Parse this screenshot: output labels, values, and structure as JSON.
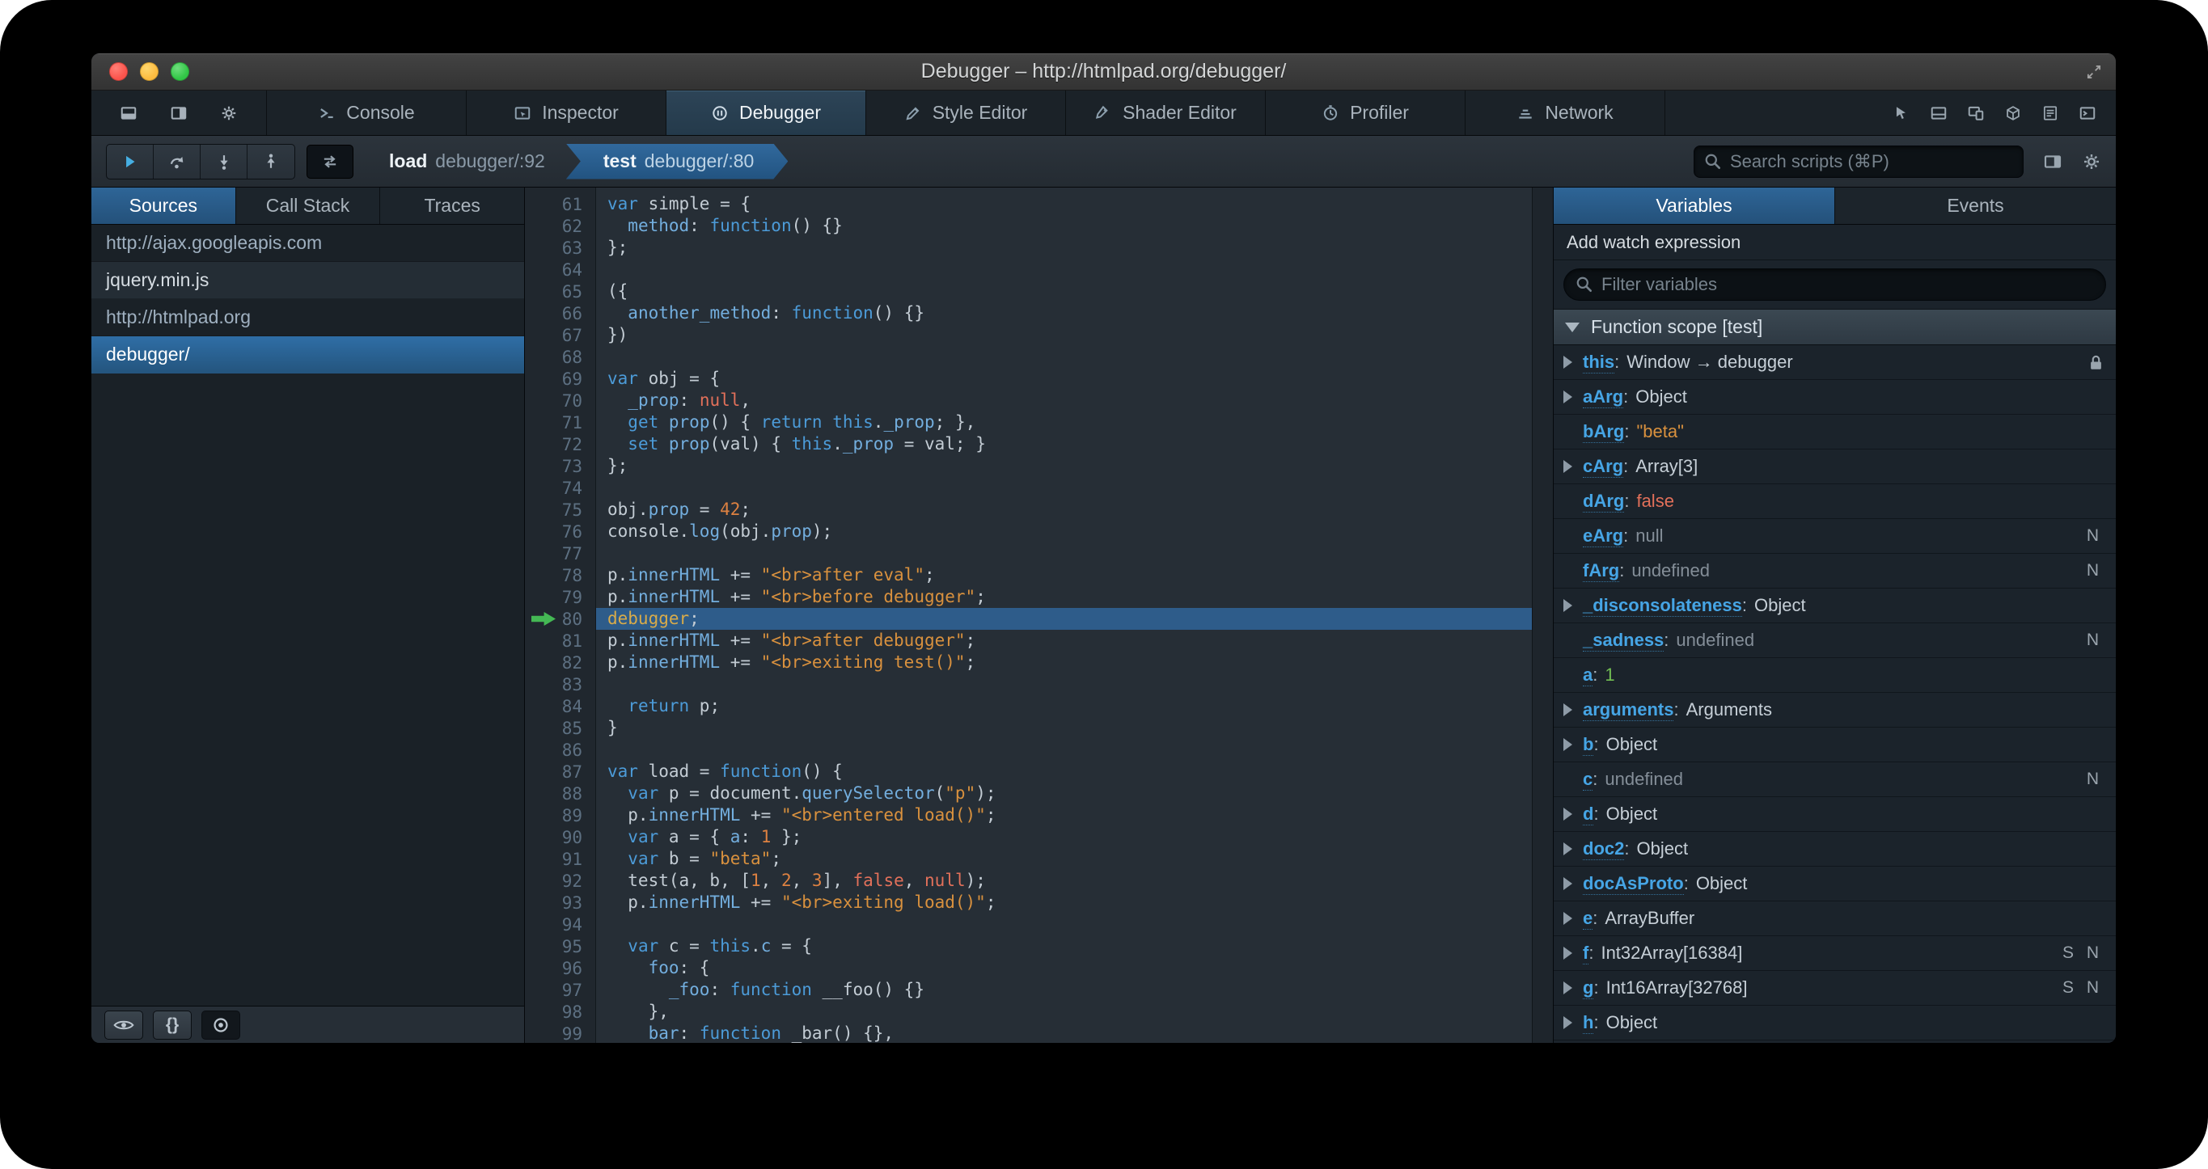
{
  "window": {
    "title": "Debugger – http://htmlpad.org/debugger/"
  },
  "colors": {
    "accent_blue": "#2e6496",
    "selection_blue": "#2e5c8a",
    "breakpoint_green": "#44b854",
    "string_orange": "#d9913e",
    "atom_red": "#e2705a",
    "number_green": "#72bf53",
    "keyword_blue": "#4c9bd8"
  },
  "devtools_tabs": {
    "items": [
      {
        "label": "Console",
        "active": false
      },
      {
        "label": "Inspector",
        "active": false
      },
      {
        "label": "Debugger",
        "active": true
      },
      {
        "label": "Style Editor",
        "active": false
      },
      {
        "label": "Shader Editor",
        "active": false
      },
      {
        "label": "Profiler",
        "active": false
      },
      {
        "label": "Network",
        "active": false
      }
    ]
  },
  "toolbar": {
    "breadcrumbs": [
      {
        "fn": "load",
        "loc": "debugger/:92",
        "active": false
      },
      {
        "fn": "test",
        "loc": "debugger/:80",
        "active": true
      }
    ],
    "search_placeholder": "Search scripts (⌘P)"
  },
  "sources": {
    "tabs": [
      "Sources",
      "Call Stack",
      "Traces"
    ],
    "active_tab": "Sources",
    "items": [
      {
        "label": "http://ajax.googleapis.com",
        "type": "group"
      },
      {
        "label": "jquery.min.js",
        "type": "file"
      },
      {
        "label": "http://htmlpad.org",
        "type": "group"
      },
      {
        "label": "debugger/",
        "type": "file",
        "selected": true
      }
    ],
    "footer": {
      "pretty_print_label": "{}"
    }
  },
  "editor": {
    "first_line": 61,
    "paused_line": 80,
    "lines": [
      [
        [
          "k",
          "var"
        ],
        [
          "d",
          " simple = {"
        ]
      ],
      [
        [
          "d",
          "  "
        ],
        [
          "p",
          "method"
        ],
        [
          "d",
          ": "
        ],
        [
          "k",
          "function"
        ],
        [
          "d",
          "() {}"
        ]
      ],
      [
        [
          "d",
          "};"
        ]
      ],
      [],
      [
        [
          "d",
          "({"
        ]
      ],
      [
        [
          "d",
          "  "
        ],
        [
          "p",
          "another_method"
        ],
        [
          "d",
          ": "
        ],
        [
          "k",
          "function"
        ],
        [
          "d",
          "() {}"
        ]
      ],
      [
        [
          "d",
          "})"
        ]
      ],
      [],
      [
        [
          "k",
          "var"
        ],
        [
          "d",
          " obj = {"
        ]
      ],
      [
        [
          "d",
          "  "
        ],
        [
          "p",
          "_prop"
        ],
        [
          "d",
          ": "
        ],
        [
          "a",
          "null"
        ],
        [
          "d",
          ","
        ]
      ],
      [
        [
          "d",
          "  "
        ],
        [
          "k",
          "get"
        ],
        [
          "d",
          " "
        ],
        [
          "p",
          "prop"
        ],
        [
          "d",
          "() { "
        ],
        [
          "k",
          "return"
        ],
        [
          "d",
          " "
        ],
        [
          "k",
          "this"
        ],
        [
          "d",
          "."
        ],
        [
          "p",
          "_prop"
        ],
        [
          "d",
          "; },"
        ]
      ],
      [
        [
          "d",
          "  "
        ],
        [
          "k",
          "set"
        ],
        [
          "d",
          " "
        ],
        [
          "p",
          "prop"
        ],
        [
          "d",
          "(val) { "
        ],
        [
          "k",
          "this"
        ],
        [
          "d",
          "."
        ],
        [
          "p",
          "_prop"
        ],
        [
          "d",
          " = val; }"
        ]
      ],
      [
        [
          "d",
          "};"
        ]
      ],
      [],
      [
        [
          "d",
          "obj."
        ],
        [
          "p",
          "prop"
        ],
        [
          "d",
          " = "
        ],
        [
          "n",
          "42"
        ],
        [
          "d",
          ";"
        ]
      ],
      [
        [
          "d",
          "console."
        ],
        [
          "p",
          "log"
        ],
        [
          "d",
          "(obj."
        ],
        [
          "p",
          "prop"
        ],
        [
          "d",
          ");"
        ]
      ],
      [],
      [
        [
          "d",
          "p."
        ],
        [
          "p",
          "innerHTML"
        ],
        [
          "d",
          " += "
        ],
        [
          "s",
          "\"<br>after eval\""
        ],
        [
          "d",
          ";"
        ]
      ],
      [
        [
          "d",
          "p."
        ],
        [
          "p",
          "innerHTML"
        ],
        [
          "d",
          " += "
        ],
        [
          "s",
          "\"<br>before debugger\""
        ],
        [
          "d",
          ";"
        ]
      ],
      [
        [
          "dbg",
          "debugger"
        ],
        [
          "d",
          ";"
        ]
      ],
      [
        [
          "d",
          "p."
        ],
        [
          "p",
          "innerHTML"
        ],
        [
          "d",
          " += "
        ],
        [
          "s",
          "\"<br>after debugger\""
        ],
        [
          "d",
          ";"
        ]
      ],
      [
        [
          "d",
          "p."
        ],
        [
          "p",
          "innerHTML"
        ],
        [
          "d",
          " += "
        ],
        [
          "s",
          "\"<br>exiting test()\""
        ],
        [
          "d",
          ";"
        ]
      ],
      [],
      [
        [
          "d",
          "  "
        ],
        [
          "k",
          "return"
        ],
        [
          "d",
          " p;"
        ]
      ],
      [
        [
          "d",
          "}"
        ]
      ],
      [],
      [
        [
          "k",
          "var"
        ],
        [
          "d",
          " load = "
        ],
        [
          "k",
          "function"
        ],
        [
          "d",
          "() {"
        ]
      ],
      [
        [
          "d",
          "  "
        ],
        [
          "k",
          "var"
        ],
        [
          "d",
          " p = document."
        ],
        [
          "p",
          "querySelector"
        ],
        [
          "d",
          "("
        ],
        [
          "s",
          "\"p\""
        ],
        [
          "d",
          ");"
        ]
      ],
      [
        [
          "d",
          "  p."
        ],
        [
          "p",
          "innerHTML"
        ],
        [
          "d",
          " += "
        ],
        [
          "s",
          "\"<br>entered load()\""
        ],
        [
          "d",
          ";"
        ]
      ],
      [
        [
          "d",
          "  "
        ],
        [
          "k",
          "var"
        ],
        [
          "d",
          " a = { "
        ],
        [
          "p",
          "a"
        ],
        [
          "d",
          ": "
        ],
        [
          "n",
          "1"
        ],
        [
          "d",
          " };"
        ]
      ],
      [
        [
          "d",
          "  "
        ],
        [
          "k",
          "var"
        ],
        [
          "d",
          " b = "
        ],
        [
          "s",
          "\"beta\""
        ],
        [
          "d",
          ";"
        ]
      ],
      [
        [
          "d",
          "  test(a, b, ["
        ],
        [
          "n",
          "1"
        ],
        [
          "d",
          ", "
        ],
        [
          "n",
          "2"
        ],
        [
          "d",
          ", "
        ],
        [
          "n",
          "3"
        ],
        [
          "d",
          "], "
        ],
        [
          "a",
          "false"
        ],
        [
          "d",
          ", "
        ],
        [
          "a",
          "null"
        ],
        [
          "d",
          ");"
        ]
      ],
      [
        [
          "d",
          "  p."
        ],
        [
          "p",
          "innerHTML"
        ],
        [
          "d",
          " += "
        ],
        [
          "s",
          "\"<br>exiting load()\""
        ],
        [
          "d",
          ";"
        ]
      ],
      [],
      [
        [
          "d",
          "  "
        ],
        [
          "k",
          "var"
        ],
        [
          "d",
          " c = "
        ],
        [
          "k",
          "this"
        ],
        [
          "d",
          "."
        ],
        [
          "p",
          "c"
        ],
        [
          "d",
          " = {"
        ]
      ],
      [
        [
          "d",
          "    "
        ],
        [
          "p",
          "foo"
        ],
        [
          "d",
          ": {"
        ]
      ],
      [
        [
          "d",
          "      "
        ],
        [
          "p",
          "_foo"
        ],
        [
          "d",
          ": "
        ],
        [
          "k",
          "function"
        ],
        [
          "d",
          " __foo() {}"
        ]
      ],
      [
        [
          "d",
          "    },"
        ]
      ],
      [
        [
          "d",
          "    "
        ],
        [
          "p",
          "bar"
        ],
        [
          "d",
          ": "
        ],
        [
          "k",
          "function"
        ],
        [
          "d",
          " _bar() {},"
        ]
      ]
    ]
  },
  "variables": {
    "tabs": [
      "Variables",
      "Events"
    ],
    "active_tab": "Variables",
    "add_watch_label": "Add watch expression",
    "filter_placeholder": "Filter variables",
    "scope_label": "Function scope [test]",
    "items": [
      {
        "name": "this",
        "value": "Window → debugger",
        "type": "object",
        "expandable": true,
        "lock": true
      },
      {
        "name": "aArg",
        "value": "Object",
        "type": "object",
        "expandable": true
      },
      {
        "name": "bArg",
        "value": "\"beta\"",
        "type": "string",
        "expandable": false
      },
      {
        "name": "cArg",
        "value": "Array[3]",
        "type": "object",
        "expandable": true
      },
      {
        "name": "dArg",
        "value": "false",
        "type": "atom",
        "expandable": false
      },
      {
        "name": "eArg",
        "value": "null",
        "type": "dim",
        "expandable": false,
        "flags": "N"
      },
      {
        "name": "fArg",
        "value": "undefined",
        "type": "dim",
        "expandable": false,
        "flags": "N"
      },
      {
        "name": "_disconsolateness",
        "value": "Object",
        "type": "object",
        "expandable": true
      },
      {
        "name": "_sadness",
        "value": "undefined",
        "type": "dim",
        "expandable": false,
        "flags": "N"
      },
      {
        "name": "a",
        "value": "1",
        "type": "number",
        "expandable": false
      },
      {
        "name": "arguments",
        "value": "Arguments",
        "type": "object",
        "expandable": true
      },
      {
        "name": "b",
        "value": "Object",
        "type": "object",
        "expandable": true
      },
      {
        "name": "c",
        "value": "undefined",
        "type": "dim",
        "expandable": false,
        "flags": "N"
      },
      {
        "name": "d",
        "value": "Object",
        "type": "object",
        "expandable": true
      },
      {
        "name": "doc2",
        "value": "Object",
        "type": "object",
        "expandable": true
      },
      {
        "name": "docAsProto",
        "value": "Object",
        "type": "object",
        "expandable": true
      },
      {
        "name": "e",
        "value": "ArrayBuffer",
        "type": "object",
        "expandable": true
      },
      {
        "name": "f",
        "value": "Int32Array[16384]",
        "type": "object",
        "expandable": true,
        "flags": "S N"
      },
      {
        "name": "g",
        "value": "Int16Array[32768]",
        "type": "object",
        "expandable": true,
        "flags": "S N"
      },
      {
        "name": "h",
        "value": "Object",
        "type": "object",
        "expandable": true
      }
    ]
  }
}
